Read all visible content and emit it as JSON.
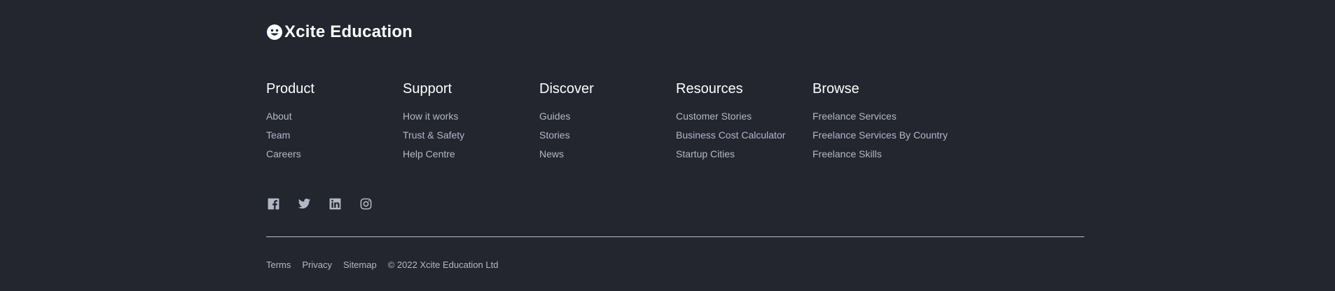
{
  "brand": {
    "name": "Xcite Education",
    "logo_icon": "smiley-face-icon"
  },
  "columns": [
    {
      "title": "Product",
      "links": [
        "About",
        "Team",
        "Careers"
      ]
    },
    {
      "title": "Support",
      "links": [
        "How it works",
        "Trust & Safety",
        "Help Centre"
      ]
    },
    {
      "title": "Discover",
      "links": [
        "Guides",
        "Stories",
        "News"
      ]
    },
    {
      "title": "Resources",
      "links": [
        "Customer Stories",
        "Business Cost Calculator",
        "Startup Cities"
      ]
    },
    {
      "title": "Browse",
      "links": [
        "Freelance Services",
        "Freelance Services By Country",
        "Freelance Skills"
      ]
    }
  ],
  "social": {
    "icons": [
      "facebook-icon",
      "twitter-icon",
      "linkedin-icon",
      "instagram-icon"
    ]
  },
  "bottom": {
    "terms": "Terms",
    "privacy": "Privacy",
    "sitemap": "Sitemap",
    "copyright": "© 2022 Xcite Education Ltd"
  },
  "colors": {
    "background": "#23262f",
    "heading": "#ffffff",
    "link": "#b3b8c8",
    "divider": "#b9bdc8"
  }
}
